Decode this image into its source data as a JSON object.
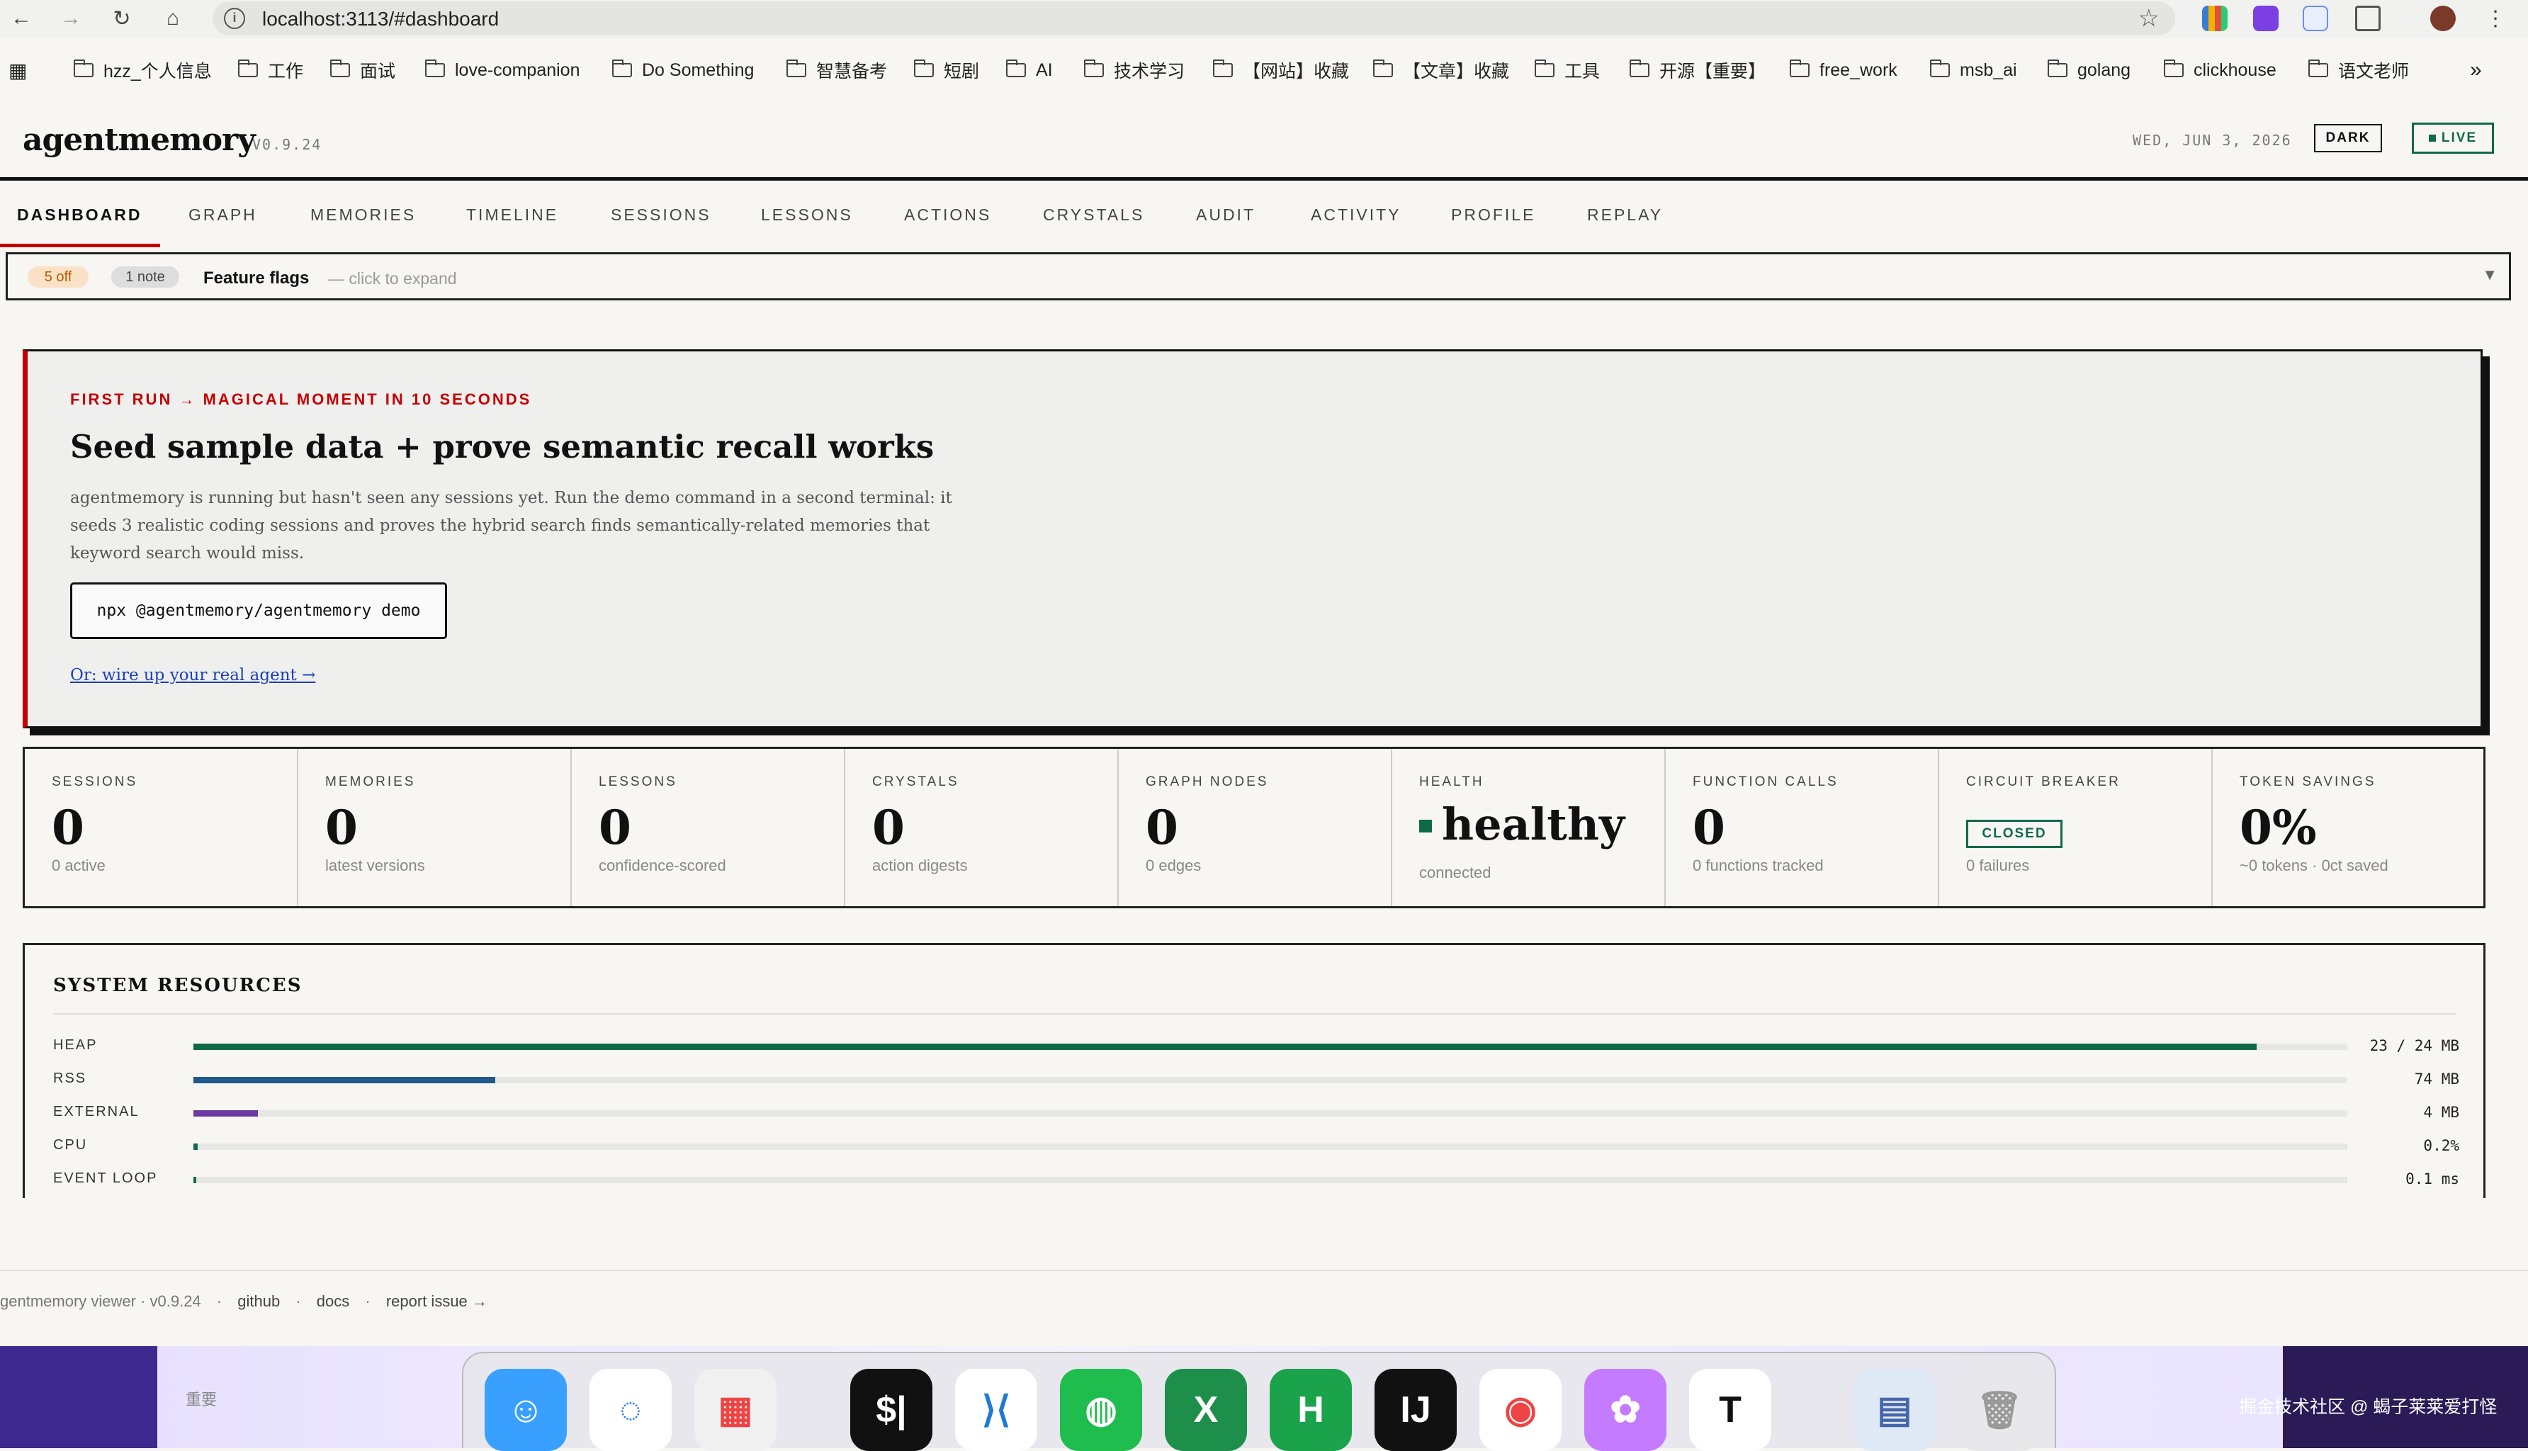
{
  "browser": {
    "url": "localhost:3113/#dashboard",
    "bookmarks": [
      "hzz_个人信息",
      "工作",
      "面试",
      "love-companion",
      "Do Something",
      "智慧备考",
      "短剧",
      "AI",
      "技术学习",
      "【网站】收藏",
      "【文章】收藏",
      "工具",
      "开源【重要】",
      "free_work",
      "msb_ai",
      "golang",
      "clickhouse",
      "语文老师"
    ],
    "more": "»"
  },
  "app": {
    "brand": "agentmemory",
    "version": "V0.9.24",
    "date": "WED, JUN 3, 2026",
    "dark_label": "DARK",
    "live_label": "LIVE",
    "accent": "#c40000",
    "green": "#0f6a4a"
  },
  "tabs": [
    "DASHBOARD",
    "GRAPH",
    "MEMORIES",
    "TIMELINE",
    "SESSIONS",
    "LESSONS",
    "ACTIONS",
    "CRYSTALS",
    "AUDIT",
    "ACTIVITY",
    "PROFILE",
    "REPLAY"
  ],
  "flags": {
    "off": "5 off",
    "note": "1 note",
    "title": "Feature flags",
    "hint": "— click to expand",
    "chevron": "▼"
  },
  "hero": {
    "eyebrow": "FIRST RUN → MAGICAL MOMENT IN 10 SECONDS",
    "title": "Seed sample data + prove semantic recall works",
    "body": "agentmemory is running but hasn't seen any sessions yet. Run the demo command in a second terminal: it seeds 3 realistic coding sessions and proves the hybrid search finds semantically-related memories that keyword search would miss.",
    "command": "npx @agentmemory/agentmemory demo",
    "link": "Or: wire up your real agent →"
  },
  "stats": [
    {
      "label": "SESSIONS",
      "value": "0",
      "sub": "0 active"
    },
    {
      "label": "MEMORIES",
      "value": "0",
      "sub": "latest versions"
    },
    {
      "label": "LESSONS",
      "value": "0",
      "sub": "confidence-scored"
    },
    {
      "label": "CRYSTALS",
      "value": "0",
      "sub": "action digests"
    },
    {
      "label": "GRAPH NODES",
      "value": "0",
      "sub": "0 edges"
    },
    {
      "label": "HEALTH",
      "value": "healthy",
      "sub": "connected"
    },
    {
      "label": "FUNCTION CALLS",
      "value": "0",
      "sub": "0 functions tracked"
    },
    {
      "label": "CIRCUIT BREAKER",
      "value": "CLOSED",
      "sub": "0 failures"
    },
    {
      "label": "TOKEN SAVINGS",
      "value": "0%",
      "sub": "~0 tokens · 0ct saved"
    }
  ],
  "resources": {
    "title": "SYSTEM RESOURCES",
    "rows": [
      {
        "label": "HEAP",
        "value": "23 / 24 MB",
        "fill": 0.958,
        "color": "#0f6a4a"
      },
      {
        "label": "RSS",
        "value": "74 MB",
        "fill": 0.14,
        "color": "#1f5a8a"
      },
      {
        "label": "EXTERNAL",
        "value": "4 MB",
        "fill": 0.03,
        "color": "#6a3aa0"
      },
      {
        "label": "CPU",
        "value": "0.2%",
        "fill": 0.002,
        "color": "#0f6a4a"
      },
      {
        "label": "EVENT LOOP",
        "value": "0.1 ms",
        "fill": 0.001,
        "color": "#0f6a4a"
      }
    ]
  },
  "footer": {
    "name": "gentmemory viewer · v0.9.24",
    "sep": "·",
    "github": "github",
    "docs": "docs",
    "report": "report issue →"
  },
  "desktop": {
    "left_text": "重要",
    "watermark": "掘金技术社区 @ 蝎子莱莱爱打怪",
    "dock_apps": [
      "finder",
      "messages",
      "launchpad",
      "terminal",
      "vscode",
      "wechat",
      "excel",
      "hbuilder",
      "intellij",
      "chrome",
      "catapp",
      "typora",
      "preview",
      "trash"
    ]
  }
}
